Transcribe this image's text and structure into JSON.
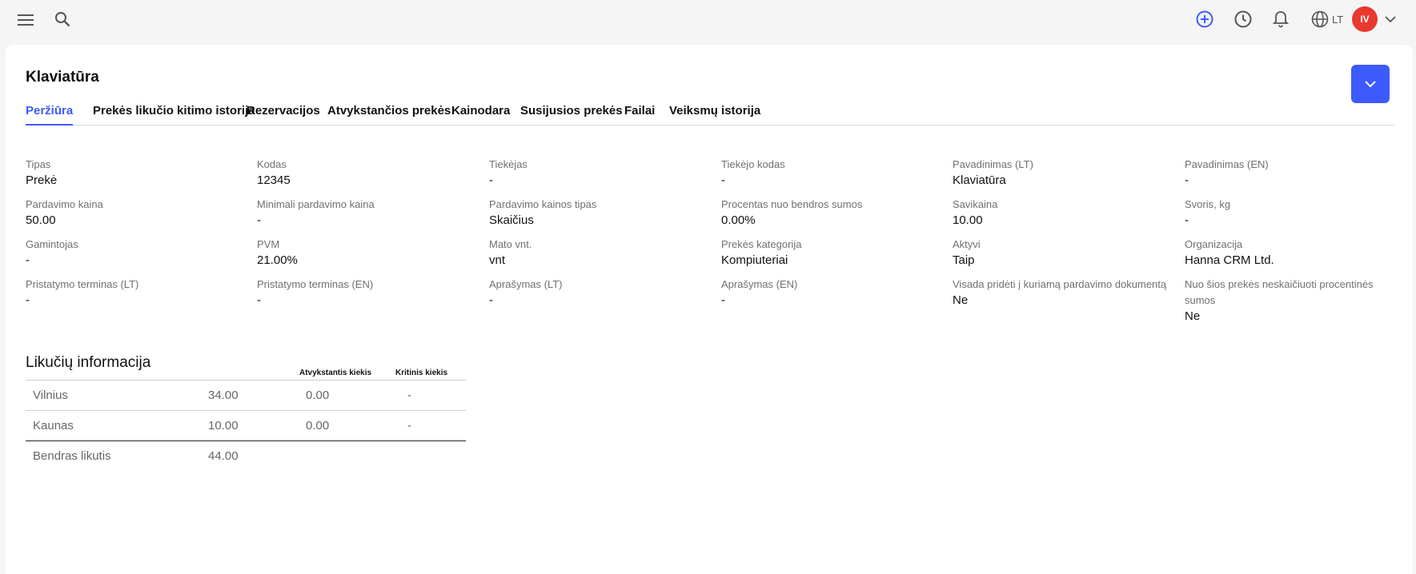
{
  "topbar": {
    "menu_icon": "hamburger-icon",
    "search_icon": "search-icon",
    "add_icon": "plus-circle-icon",
    "history_icon": "clock-icon",
    "notifications_icon": "bell-icon",
    "language_icon": "globe-icon",
    "language": "LT",
    "user_initials": "IV",
    "user_menu_icon": "chevron-down-icon"
  },
  "page": {
    "title": "Klaviatūra",
    "expand_icon": "chevron-down-icon"
  },
  "tabs": [
    {
      "label": "Peržiūra",
      "active": true
    },
    {
      "label": "Prekės likučio kitimo istorija"
    },
    {
      "label": "Rezervacijos"
    },
    {
      "label": "Atvykstančios prekės"
    },
    {
      "label": "Kainodara"
    },
    {
      "label": "Susijusios prekės"
    },
    {
      "label": "Failai"
    },
    {
      "label": "Veiksmų istorija"
    }
  ],
  "fields": [
    {
      "label": "Tipas",
      "value": "Prekė"
    },
    {
      "label": "Kodas",
      "value": "12345"
    },
    {
      "label": "Tiekėjas",
      "value": "-"
    },
    {
      "label": "Tiekėjo kodas",
      "value": "-"
    },
    {
      "label": "Pavadinimas (LT)",
      "value": "Klaviatūra"
    },
    {
      "label": "Pavadinimas (EN)",
      "value": "-"
    },
    {
      "label": "Pardavimo kaina",
      "value": "50.00"
    },
    {
      "label": "Minimali pardavimo kaina",
      "value": "-"
    },
    {
      "label": "Pardavimo kainos tipas",
      "value": "Skaičius"
    },
    {
      "label": "Procentas nuo bendros sumos",
      "value": "0.00%"
    },
    {
      "label": "Savikaina",
      "value": "10.00"
    },
    {
      "label": "Svoris, kg",
      "value": "-"
    },
    {
      "label": "Gamintojas",
      "value": "-"
    },
    {
      "label": "PVM",
      "value": "21.00%"
    },
    {
      "label": "Mato vnt.",
      "value": "vnt"
    },
    {
      "label": "Prekės kategorija",
      "value": "Kompiuteriai"
    },
    {
      "label": "Aktyvi",
      "value": "Taip"
    },
    {
      "label": "Organizacija",
      "value": "Hanna CRM Ltd."
    },
    {
      "label": "Pristatymo terminas (LT)",
      "value": "-"
    },
    {
      "label": "Pristatymo terminas (EN)",
      "value": "-"
    },
    {
      "label": "Aprašymas (LT)",
      "value": "-"
    },
    {
      "label": "Aprašymas (EN)",
      "value": "-"
    },
    {
      "label": "Visada pridėti į kuriamą pardavimo dokumentą",
      "value": "Ne"
    },
    {
      "label": "Nuo šios prekės neskaičiuoti procentinės sumos",
      "value": "Ne"
    }
  ],
  "stock": {
    "title": "Likučių informacija",
    "columns": [
      "Atvykstantis kiekis",
      "Kritinis kiekis"
    ],
    "rows": [
      {
        "location": "Vilnius",
        "quantity": "34.00",
        "incoming": "0.00",
        "critical": "-"
      },
      {
        "location": "Kaunas",
        "quantity": "10.00",
        "incoming": "0.00",
        "critical": "-"
      }
    ],
    "total": {
      "label": "Bendras likutis",
      "quantity": "44.00"
    }
  },
  "colors": {
    "accent": "#3d5afe",
    "avatar": "#e8392e"
  }
}
